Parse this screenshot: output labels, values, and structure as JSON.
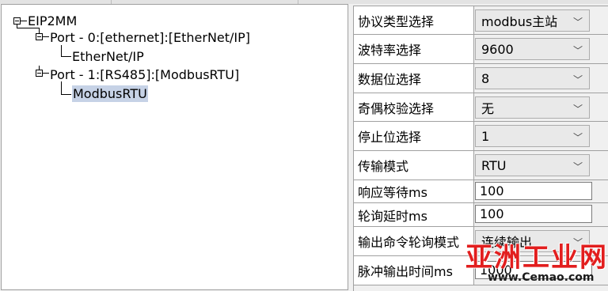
{
  "tree": {
    "root": {
      "label": "EIP2MM"
    },
    "ports": [
      {
        "label": "Port - 0:[ethernet]:[EtherNet/IP]",
        "child": "EtherNet/IP"
      },
      {
        "label": "Port - 1:[RS485]:[ModbusRTU]",
        "child": "ModbusRTU"
      }
    ]
  },
  "props": [
    {
      "label": "协议类型选择",
      "value": "modbus主站",
      "kind": "dropdown"
    },
    {
      "label": "波特率选择",
      "value": "9600",
      "kind": "dropdown"
    },
    {
      "label": "数据位选择",
      "value": "8",
      "kind": "dropdown"
    },
    {
      "label": "奇偶校验选择",
      "value": "无",
      "kind": "dropdown"
    },
    {
      "label": "停止位选择",
      "value": "1",
      "kind": "dropdown"
    },
    {
      "label": "传输模式",
      "value": "RTU",
      "kind": "dropdown"
    },
    {
      "label": "响应等待ms",
      "value": "100",
      "kind": "text"
    },
    {
      "label": "轮询延时ms",
      "value": "100",
      "kind": "text"
    },
    {
      "label": "输出命令轮询模式",
      "value": "连续输出",
      "kind": "dropdown"
    },
    {
      "label": "脉冲输出时间ms",
      "value": "1000",
      "kind": "text"
    }
  ],
  "icons": {
    "dropdown": "chevron-down-icon",
    "expander": "collapse-minus-icon"
  },
  "colors": {
    "selection": "#c6d2e6",
    "watermark": "#e21e1e"
  },
  "watermark": {
    "title": "亚洲工业网",
    "url": "www.Cemao.com"
  }
}
